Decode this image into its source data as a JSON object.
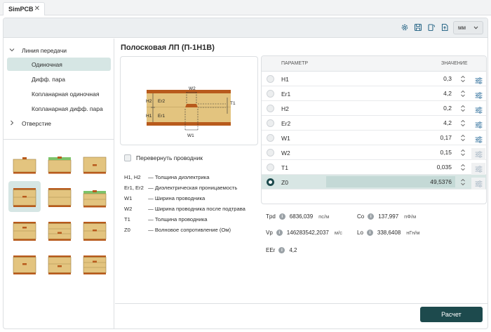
{
  "app": {
    "tab_title": "SimPCB",
    "tab_close": "✕"
  },
  "toolbar": {
    "icons": [
      "gear-icon",
      "save-icon",
      "rotate-icon",
      "export-icon"
    ],
    "unit_value": "мм"
  },
  "sidebar": {
    "tree": [
      {
        "label": "Линия передачи",
        "level": 0,
        "expanded": true
      },
      {
        "label": "Одиночная",
        "level": 1,
        "selected": true
      },
      {
        "label": "Дифф. пара",
        "level": 1
      },
      {
        "label": "Копланарная одиночная",
        "level": 1
      },
      {
        "label": "Копланарная дифф. пара",
        "level": 1
      },
      {
        "label": "Отверстие",
        "level": 0,
        "expanded": false
      }
    ],
    "selected_thumbnail": 3
  },
  "main": {
    "title": "Полосковая ЛП (П-1Н1В)",
    "diagram_labels": {
      "w2": "W2",
      "w1": "W1",
      "h2": "H2",
      "h1": "H1",
      "er2": "Er2",
      "er1": "Er1",
      "t1": "T1"
    },
    "flip_label": "Перевернуть проводник",
    "legend": [
      {
        "key": "H1, H2",
        "desc": "Толщина диэлектрика"
      },
      {
        "key": "Er1, Er2",
        "desc": "Диэлектрическая проницаемость"
      },
      {
        "key": "W1",
        "desc": "Ширина проводника"
      },
      {
        "key": "W2",
        "desc": "Ширина проводника после подтрава"
      },
      {
        "key": "T1",
        "desc": "Толщина проводника"
      },
      {
        "key": "Z0",
        "desc": "Волновое сопротивление (Ом)"
      }
    ],
    "dash": "—"
  },
  "params": {
    "header": {
      "name": "ПАРАМЕТР",
      "value": "ЗНАЧЕНИЕ"
    },
    "rows": [
      {
        "name": "H1",
        "value": "0,3"
      },
      {
        "name": "Er1",
        "value": "4,2"
      },
      {
        "name": "H2",
        "value": "0,2"
      },
      {
        "name": "Er2",
        "value": "4,2"
      },
      {
        "name": "W1",
        "value": "0,17"
      },
      {
        "name": "W2",
        "value": "0,15"
      },
      {
        "name": "T1",
        "value": "0,035"
      },
      {
        "name": "Z0",
        "value": "49,5376"
      }
    ]
  },
  "results": [
    {
      "label": "Tpd",
      "value": "6836,039",
      "unit": "пс/м"
    },
    {
      "label": "Co",
      "value": "137,997",
      "unit": "пФ/м"
    },
    {
      "label": "Vp",
      "value": "146283542,2037",
      "unit": "м/с"
    },
    {
      "label": "Lo",
      "value": "338,6408",
      "unit": "нГн/м"
    },
    {
      "label": "EEr",
      "value": "4,2",
      "unit": ""
    }
  ],
  "info_glyph": "i",
  "footer": {
    "calc_label": "Расчет"
  }
}
